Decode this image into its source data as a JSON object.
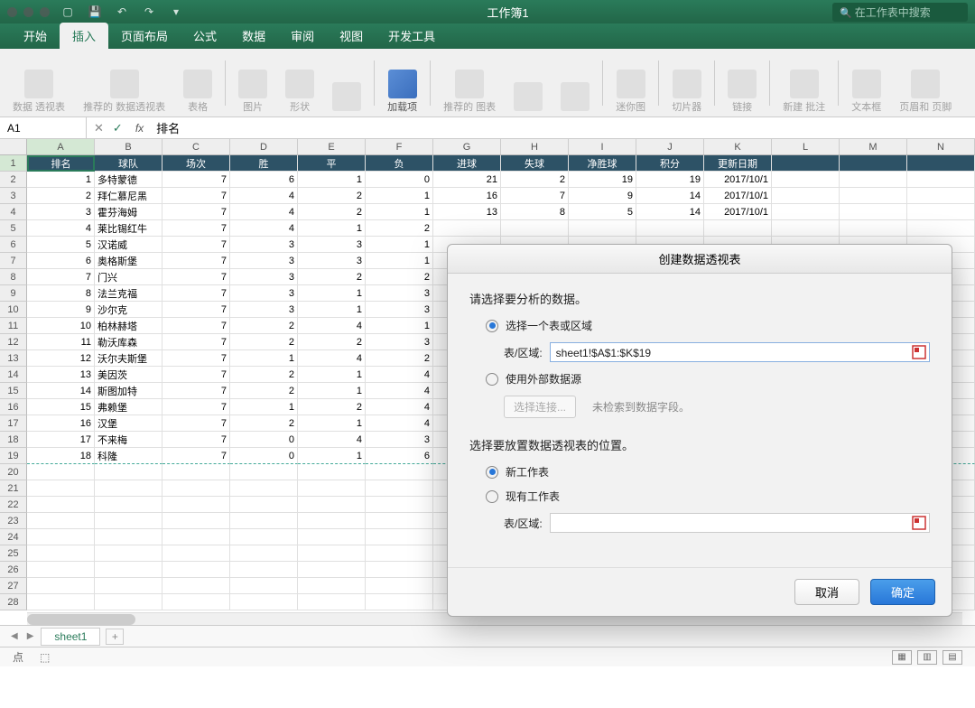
{
  "window": {
    "title": "工作簿1",
    "search_placeholder": "在工作表中搜索"
  },
  "tabs": [
    "开始",
    "插入",
    "页面布局",
    "公式",
    "数据",
    "审阅",
    "视图",
    "开发工具"
  ],
  "active_tab": 1,
  "ribbon": [
    {
      "label": "数据\n透视表"
    },
    {
      "label": "推荐的\n数据透视表"
    },
    {
      "label": "表格"
    },
    {
      "label": "图片"
    },
    {
      "label": "形状"
    },
    {
      "label": ""
    },
    {
      "label": "加载项",
      "active": true
    },
    {
      "label": "推荐的\n图表"
    },
    {
      "label": ""
    },
    {
      "label": ""
    },
    {
      "label": "迷你图"
    },
    {
      "label": "切片器"
    },
    {
      "label": "链接"
    },
    {
      "label": "新建\n批注"
    },
    {
      "label": "文本框"
    },
    {
      "label": "页眉和\n页脚"
    }
  ],
  "namebox": "A1",
  "formula": "排名",
  "columns": [
    "A",
    "B",
    "C",
    "D",
    "E",
    "F",
    "G",
    "H",
    "I",
    "J",
    "K",
    "L",
    "M",
    "N"
  ],
  "headers": [
    "排名",
    "球队",
    "场次",
    "胜",
    "平",
    "负",
    "进球",
    "失球",
    "净胜球",
    "积分",
    "更新日期"
  ],
  "data": [
    [
      1,
      "多特蒙德",
      7,
      6,
      1,
      0,
      21,
      2,
      19,
      19,
      "2017/10/1"
    ],
    [
      2,
      "拜仁慕尼黑",
      7,
      4,
      2,
      1,
      16,
      7,
      9,
      14,
      "2017/10/1"
    ],
    [
      3,
      "霍芬海姆",
      7,
      4,
      2,
      1,
      13,
      8,
      5,
      14,
      "2017/10/1"
    ],
    [
      4,
      "莱比锡红牛",
      7,
      4,
      1,
      2,
      "",
      "",
      "",
      "",
      "",
      ""
    ],
    [
      5,
      "汉诺威",
      7,
      3,
      3,
      1,
      "",
      "",
      "",
      "",
      "",
      ""
    ],
    [
      6,
      "奥格斯堡",
      7,
      3,
      3,
      1,
      "",
      "",
      "",
      "",
      "",
      ""
    ],
    [
      7,
      "门兴",
      7,
      3,
      2,
      2,
      "",
      "",
      "",
      "",
      "",
      ""
    ],
    [
      8,
      "法兰克福",
      7,
      3,
      1,
      3,
      "",
      "",
      "",
      "",
      "",
      ""
    ],
    [
      9,
      "沙尔克",
      7,
      3,
      1,
      3,
      "",
      "",
      "",
      "",
      "",
      ""
    ],
    [
      10,
      "柏林赫塔",
      7,
      2,
      4,
      1,
      "",
      "",
      "",
      "",
      "",
      ""
    ],
    [
      11,
      "勒沃库森",
      7,
      2,
      2,
      3,
      "",
      "",
      "",
      "",
      "",
      ""
    ],
    [
      12,
      "沃尔夫斯堡",
      7,
      1,
      4,
      2,
      "",
      "",
      "",
      "",
      "",
      ""
    ],
    [
      13,
      "美因茨",
      7,
      2,
      1,
      4,
      "",
      "",
      "",
      "",
      "",
      ""
    ],
    [
      14,
      "斯图加特",
      7,
      2,
      1,
      4,
      "",
      "",
      "",
      "",
      "",
      ""
    ],
    [
      15,
      "弗赖堡",
      7,
      1,
      2,
      4,
      "",
      "",
      "",
      "",
      "",
      ""
    ],
    [
      16,
      "汉堡",
      7,
      2,
      1,
      4,
      "",
      "",
      "",
      "",
      "",
      ""
    ],
    [
      17,
      "不来梅",
      7,
      0,
      4,
      3,
      "",
      "",
      "",
      "",
      "",
      ""
    ],
    [
      18,
      "科隆",
      7,
      0,
      1,
      6,
      "",
      "",
      "",
      "",
      "",
      ""
    ]
  ],
  "sheet_name": "sheet1",
  "status": {
    "point": "点"
  },
  "dialog": {
    "title": "创建数据透视表",
    "section1": "请选择要分析的数据。",
    "opt1": "选择一个表或区域",
    "field1_label": "表/区域:",
    "field1_value": "sheet1!$A$1:$K$19",
    "opt2": "使用外部数据源",
    "btn_conn": "选择连接...",
    "hint_conn": "未检索到数据字段。",
    "section2": "选择要放置数据透视表的位置。",
    "opt3": "新工作表",
    "opt4": "现有工作表",
    "field2_label": "表/区域:",
    "cancel": "取消",
    "ok": "确定"
  }
}
